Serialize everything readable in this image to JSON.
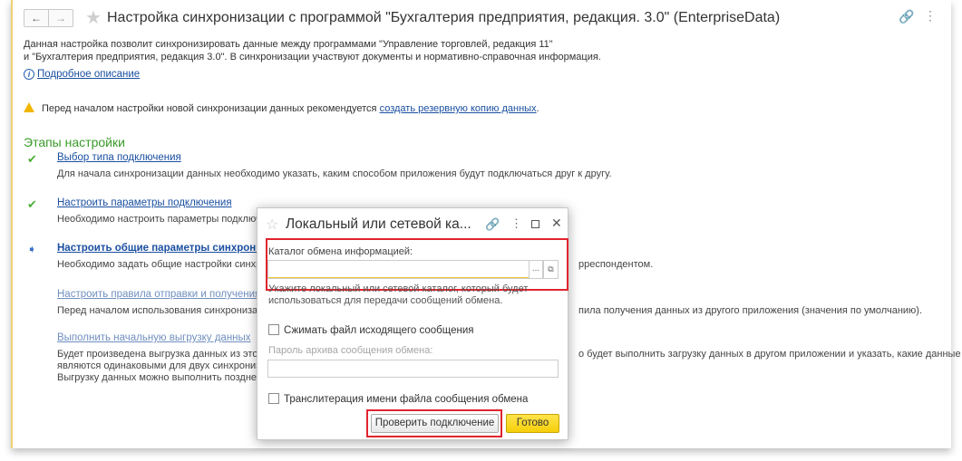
{
  "window": {
    "title": "Настройка синхронизации с программой \"Бухгалтерия предприятия, редакция. 3.0\" (EnterpriseData)",
    "back_glyph": "←",
    "forward_glyph": "→",
    "star_glyph": "★",
    "link_glyph": "🔗",
    "more_glyph": "⋮"
  },
  "intro": {
    "line1": "Данная настройка позволит синхронизировать данные между программами \"Управление торговлей, редакция 11\"",
    "line2": "и \"Бухгалтерия предприятия, редакция 3.0\".  В синхронизации участвуют документы и нормативно-справочная информация.",
    "info_glyph": "i",
    "more_link": "Подробное описание"
  },
  "warning": {
    "text": "Перед началом настройки новой синхронизации данных рекомендуется ",
    "link": "создать резервную копию данных",
    "suffix": "."
  },
  "stages": {
    "title": "Этапы настройки",
    "check_glyph": "✔",
    "arrow_glyph": "➧",
    "items": [
      {
        "label": "Выбор типа подключения",
        "text": "Для начала синхронизации данных необходимо указать, каким способом приложения будут подключаться друг к другу.",
        "status": "done"
      },
      {
        "label": "Настроить параметры подключения",
        "text": "Необходимо настроить параметры подключения",
        "status": "done"
      },
      {
        "label": "Настроить общие параметры синхронизации",
        "text": "Необходимо задать общие настройки синхронизации",
        "text_right": "рреспондентом.",
        "status": "current"
      },
      {
        "label": "Настроить правила отправки и получения данных",
        "text": "Перед началом использования синхронизации данных",
        "text_right": "пила получения данных из другого приложения (значения по умолчанию).",
        "status": "pending"
      },
      {
        "label": "Выполнить начальную выгрузку данных",
        "text": "Будет произведена выгрузка данных из этого приложения",
        "text_right": "о будет выполнить загрузку данных в другом приложении и указать, какие данные",
        "text2": "являются одинаковыми для двух синхронизируемых приложений.",
        "text3": "Выгрузку данных можно выполнить позднее из",
        "status": "pending"
      }
    ]
  },
  "dialog": {
    "title": "Локальный или сетевой ка...",
    "star_glyph": "☆",
    "link_glyph": "🔗",
    "more_glyph": "⋮",
    "close_glyph": "✕",
    "catalog_label": "Каталог обмена информацией:",
    "catalog_value": "",
    "dots_glyph": "...",
    "open_glyph": "⧉",
    "hint": "Укажите локальный или сетевой каталог, который будет использоваться для передачи сообщений обмена.",
    "compress_label": "Сжимать файл исходящего сообщения",
    "compress_checked": false,
    "password_label": "Пароль архива сообщения обмена:",
    "password_value": "",
    "translit_label": "Транслитерация имени файла сообщения обмена",
    "translit_checked": false,
    "check_button": "Проверить подключение",
    "done_button": "Готово"
  },
  "colors": {
    "accent_green": "#3a9a2a",
    "link_blue": "#1a4fa0",
    "highlight_red": "#e0242e",
    "primary_yellow": "#f5cf0a"
  }
}
